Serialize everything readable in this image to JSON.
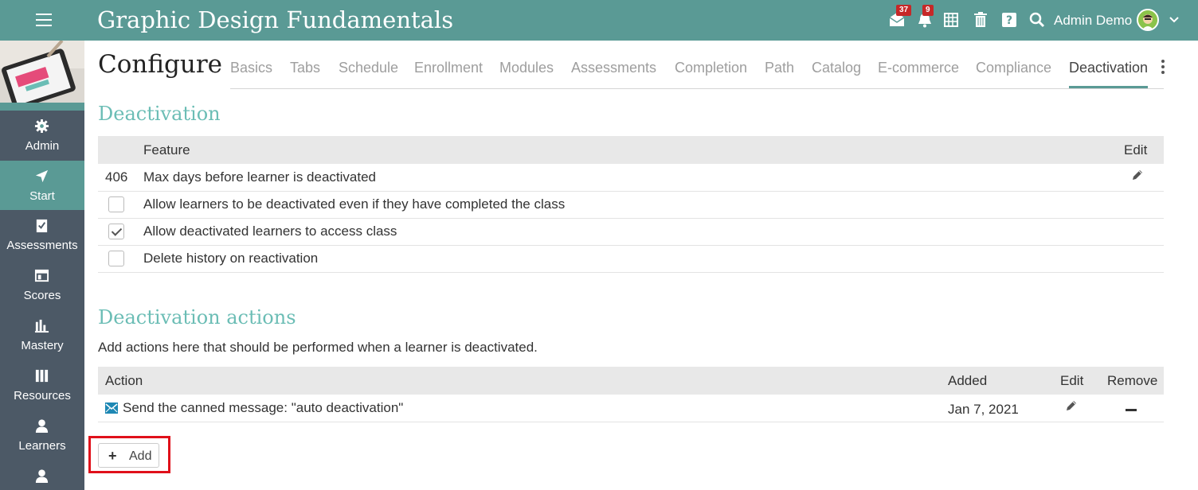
{
  "header": {
    "title": "Graphic Design Fundamentals",
    "mail_count": "37",
    "notif_count": "9",
    "user_name": "Admin Demo"
  },
  "sidebar": {
    "items": [
      {
        "label": "Admin",
        "icon": "gear-icon"
      },
      {
        "label": "Start",
        "icon": "navigation-arrow-icon"
      },
      {
        "label": "Assessments",
        "icon": "checklist-icon"
      },
      {
        "label": "Scores",
        "icon": "gradebook-icon"
      },
      {
        "label": "Mastery",
        "icon": "bar-chart-icon"
      },
      {
        "label": "Resources",
        "icon": "books-icon"
      },
      {
        "label": "Learners",
        "icon": "person-icon"
      }
    ]
  },
  "page": {
    "title": "Configure",
    "tabs": [
      "Basics",
      "Tabs",
      "Schedule",
      "Enrollment",
      "Modules",
      "Assessments",
      "Completion",
      "Path",
      "Catalog",
      "E-commerce",
      "Compliance",
      "Deactivation"
    ],
    "active_tab": "Deactivation"
  },
  "deactivation": {
    "title": "Deactivation",
    "headers": {
      "feature": "Feature",
      "edit": "Edit"
    },
    "rows": [
      {
        "value": "406",
        "label": "Max days before learner is deactivated"
      },
      {
        "checked": false,
        "label": "Allow learners to be deactivated even if they have completed the class"
      },
      {
        "checked": true,
        "label": "Allow deactivated learners to access class"
      },
      {
        "checked": false,
        "label": "Delete history on reactivation"
      }
    ]
  },
  "actions": {
    "title": "Deactivation actions",
    "description": "Add actions here that should be performed when a learner is deactivated.",
    "headers": {
      "action": "Action",
      "added": "Added",
      "edit": "Edit",
      "remove": "Remove"
    },
    "rows": [
      {
        "action": "Send the canned message: \"auto deactivation\"",
        "added": "Jan 7, 2021"
      }
    ],
    "add_label": "Add"
  },
  "colors": {
    "accent": "#5a9a95",
    "section_title": "#6bbdb5",
    "sidebar": "#4c5966",
    "badge": "#c62828",
    "highlight": "#e0101a"
  }
}
